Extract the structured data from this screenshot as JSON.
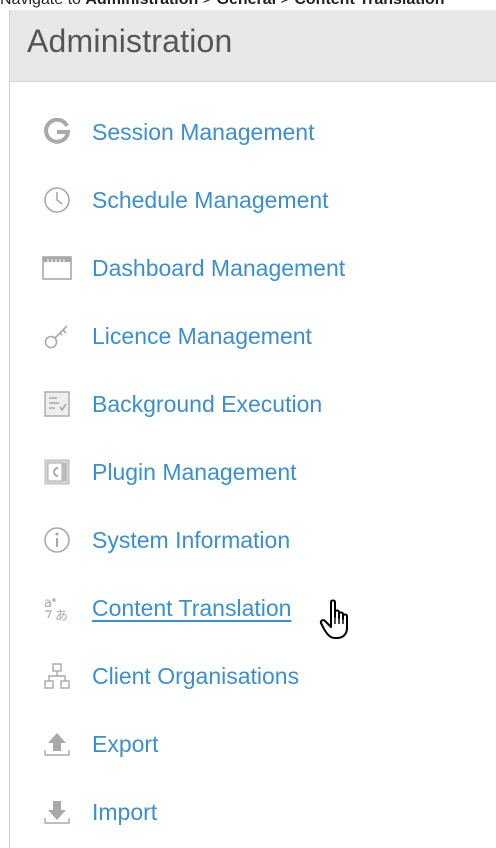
{
  "caption": {
    "prefix": "Navigate to ",
    "part1": "Administration",
    "sep1": " > ",
    "part2": "General",
    "sep2": " > ",
    "part3": "Content Translation"
  },
  "panel": {
    "title": "Administration"
  },
  "menu": {
    "items": [
      {
        "label": "Session Management",
        "icon": "session-icon"
      },
      {
        "label": "Schedule Management",
        "icon": "clock-icon"
      },
      {
        "label": "Dashboard Management",
        "icon": "dashboard-icon"
      },
      {
        "label": "Licence Management",
        "icon": "key-icon"
      },
      {
        "label": "Background Execution",
        "icon": "checklist-icon"
      },
      {
        "label": "Plugin Management",
        "icon": "plugin-icon"
      },
      {
        "label": "System Information",
        "icon": "info-icon"
      },
      {
        "label": "Content Translation",
        "icon": "translate-icon",
        "active": true
      },
      {
        "label": "Client Organisations",
        "icon": "org-chart-icon"
      },
      {
        "label": "Export",
        "icon": "export-icon"
      },
      {
        "label": "Import",
        "icon": "import-icon"
      }
    ]
  },
  "colors": {
    "link": "#3b8fd0",
    "icon": "#a9a9a9",
    "header_bg": "#e8e8e8"
  }
}
